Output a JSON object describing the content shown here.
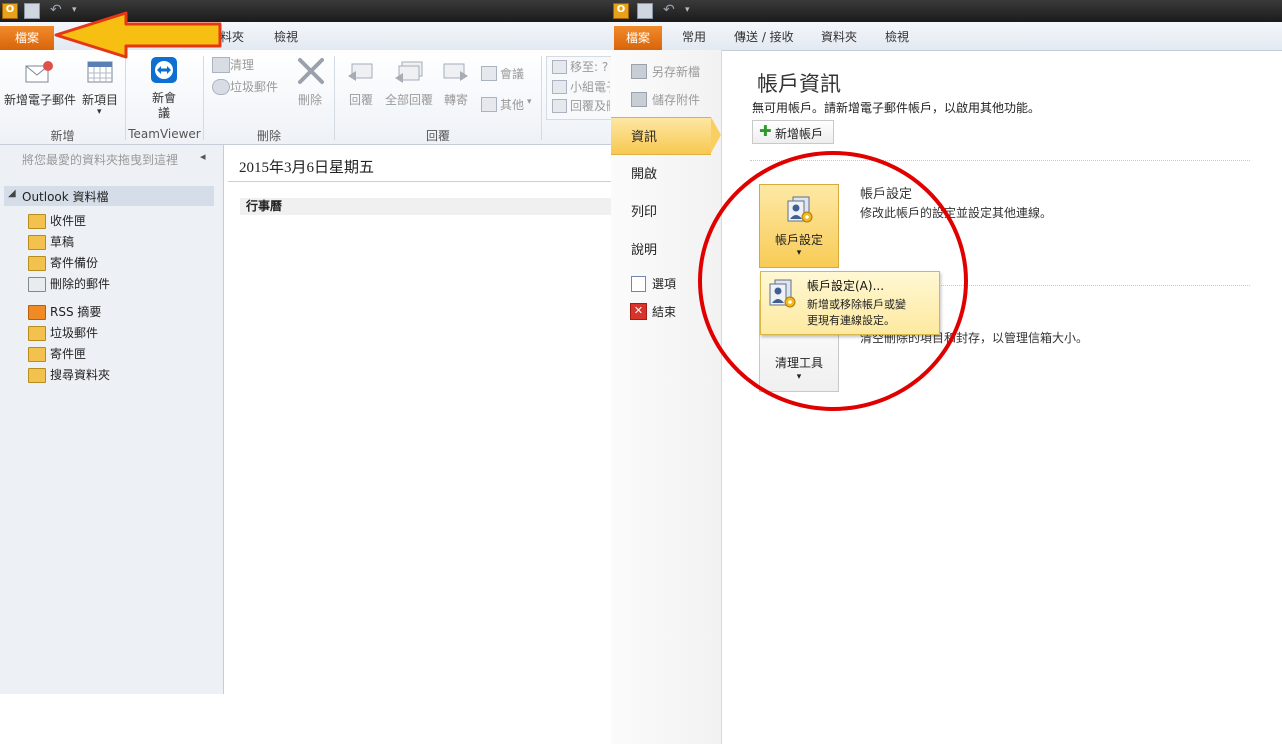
{
  "left_window": {
    "tabs": {
      "file": "檔案",
      "partial_folder": "料夾",
      "view": "檢視"
    },
    "ribbon": {
      "new_email": "新增電子郵件",
      "new_items": "新項目",
      "new_meeting": "新會議",
      "clean_up": "清理",
      "junk": "垃圾郵件",
      "delete": "刪除",
      "reply": "回覆",
      "reply_all": "全部回覆",
      "forward": "轉寄",
      "meeting": "會議",
      "more": "其他",
      "move_to": "移至: ?",
      "team_email": "小組電子",
      "reply_delete": "回覆及刪",
      "groups": {
        "new": "新增",
        "teamviewer": "TeamViewer",
        "delete": "刪除",
        "respond": "回覆"
      }
    },
    "nav": {
      "favorites_hint": "將您最愛的資料夾拖曳到這裡",
      "root": "Outlook 資料檔",
      "folders": [
        "收件匣",
        "草稿",
        "寄件備份",
        "刪除的郵件",
        "RSS 摘要",
        "垃圾郵件",
        "寄件匣",
        "搜尋資料夾"
      ]
    },
    "calendar": {
      "date": "2015年3月6日星期五",
      "section": "行事曆"
    }
  },
  "right_window": {
    "tabs": {
      "file": "檔案",
      "home": "常用",
      "send_receive": "傳送 / 接收",
      "folder": "資料夾",
      "view": "檢視"
    },
    "backstage_nav": {
      "save_as": "另存新檔",
      "save_attachments": "儲存附件",
      "info": "資訊",
      "open": "開啟",
      "print": "列印",
      "help": "說明",
      "options": "選項",
      "exit": "結束"
    },
    "account_info": {
      "title": "帳戶資訊",
      "no_account": "無可用帳戶。請新增電子郵件帳戶，以啟用其他功能。",
      "add_account": "新增帳戶",
      "settings_title": "帳戶設定",
      "settings_desc": "修改此帳戶的設定並設定其他連線。",
      "settings_button": "帳戶設定",
      "cleanup_button": "清理工具",
      "cleanup_desc": "清空刪除的項目和封存，以管理信箱大小。",
      "popup_title": "帳戶設定(A)...",
      "popup_desc1": "新增或移除帳戶或變",
      "popup_desc2": "更現有連線設定。"
    }
  },
  "colors": {
    "file_tab": "#e8740f",
    "highlight_arrow": "#f5c518",
    "circle": "#e00000"
  }
}
